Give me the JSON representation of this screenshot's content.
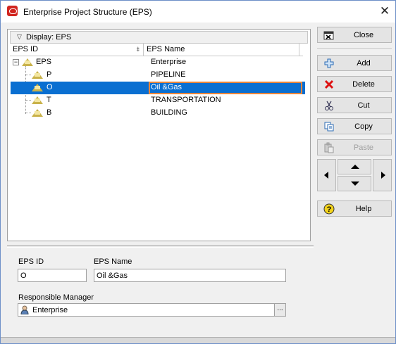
{
  "window": {
    "title": "Enterprise Project Structure (EPS)",
    "close_glyph": "✕",
    "app_icon": "oracle-app-icon"
  },
  "tree": {
    "display_label": "Display: EPS",
    "columns": [
      "EPS ID",
      "EPS Name"
    ],
    "rows": [
      {
        "id": "EPS",
        "name": "Enterprise",
        "expander": "−",
        "selected": false
      },
      {
        "id": "P",
        "name": "PIPELINE",
        "selected": false
      },
      {
        "id": "O",
        "name": "Oil &Gas",
        "selected": true
      },
      {
        "id": "T",
        "name": "TRANSPORTATION",
        "selected": false
      },
      {
        "id": "B",
        "name": "BUILDING",
        "selected": false
      }
    ]
  },
  "buttons": {
    "close": "Close",
    "add": "Add",
    "delete": "Delete",
    "cut": "Cut",
    "copy": "Copy",
    "paste": "Paste",
    "help": "Help"
  },
  "details": {
    "eps_id_label": "EPS ID",
    "eps_id_value": "O",
    "eps_name_label": "EPS Name",
    "eps_name_value": "Oil &Gas",
    "manager_label": "Responsible Manager",
    "manager_value": "Enterprise",
    "browse_label": "..."
  },
  "colors": {
    "selection": "#0a6fd1",
    "edit_border": "#e7853b",
    "title_icon": "#d1251f"
  }
}
